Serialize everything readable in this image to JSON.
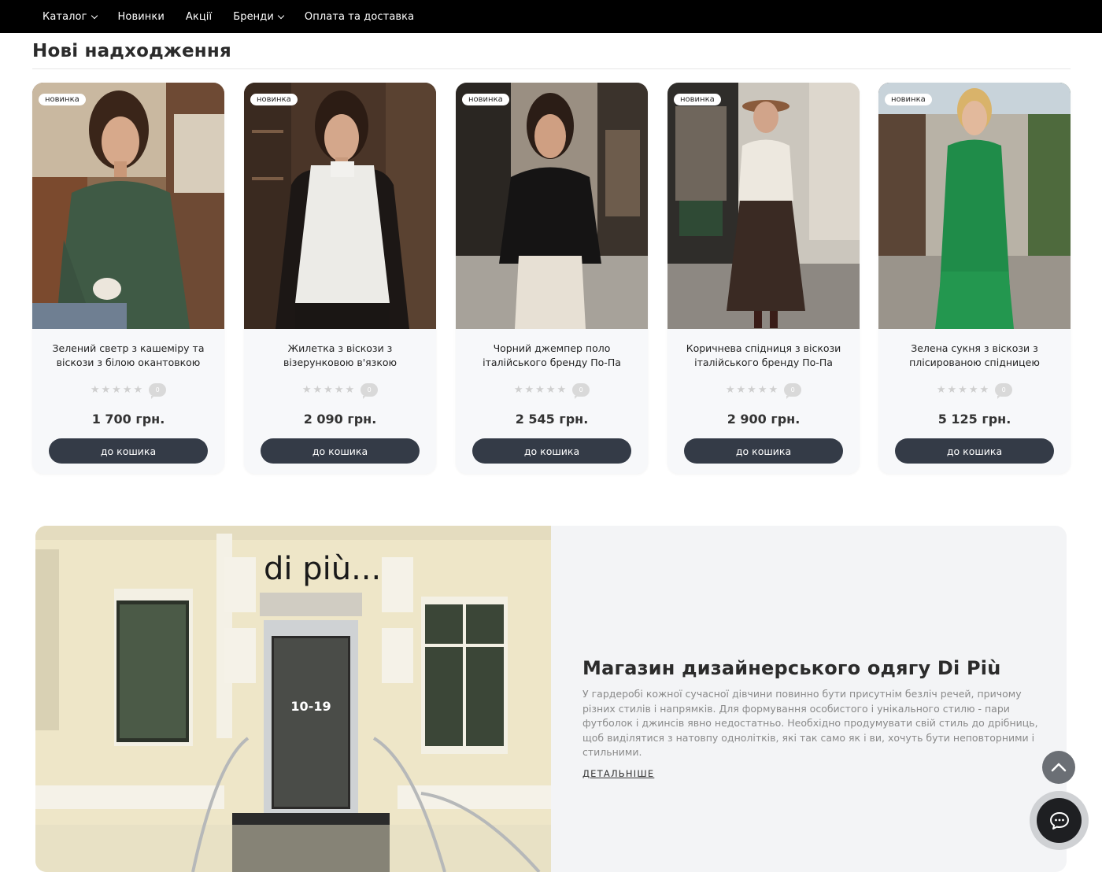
{
  "nav": {
    "items": [
      {
        "label": "Каталог",
        "dropdown": true
      },
      {
        "label": "Новинки",
        "dropdown": false
      },
      {
        "label": "Акції",
        "dropdown": false
      },
      {
        "label": "Бренди",
        "dropdown": true
      },
      {
        "label": "Оплата та доставка",
        "dropdown": false
      }
    ]
  },
  "section": {
    "title": "Нові надходження"
  },
  "products": [
    {
      "badge": "новинка",
      "name": "Зелений светр з кашеміру та віскози з білою окантовкою",
      "price": "1 700 грн.",
      "reviews": "0",
      "button": "до кошика"
    },
    {
      "badge": "новинка",
      "name": "Жилетка з віскози з візерунковою в'язкою",
      "price": "2 090 грн.",
      "reviews": "0",
      "button": "до кошика"
    },
    {
      "badge": "новинка",
      "name": "Чорний джемпер поло італійського бренду По-Па",
      "price": "2 545 грн.",
      "reviews": "0",
      "button": "до кошика"
    },
    {
      "badge": "новинка",
      "name": "Коричнева спідниця з віскози італійського бренду По-Па",
      "price": "2 900 грн.",
      "reviews": "0",
      "button": "до кошика"
    },
    {
      "badge": "новинка",
      "name": "Зелена сукня з віскози з плісированою спідницею",
      "price": "5 125 грн.",
      "reviews": "0",
      "button": "до кошика"
    }
  ],
  "store": {
    "sign": "di più...",
    "door_number": "10-19",
    "title": "Магазин дизайнерського одягу Di Più",
    "text": "У гардеробі кожної сучасної дівчини повинно бути присутнім безліч речей, причому різних стилів і напрямків. Для формування особистого і унікального стилю - пари футболок і джинсів явно недостатньо. Необхідно продумувати свій стиль до дрібниць, щоб виділятися з натовпу однолітків, які так само як і ви, хочуть бути неповторними і стильними.",
    "more_link": "ДЕТАЛЬНІШЕ"
  },
  "floating": {
    "scroll_top_icon": "chevron-up-icon",
    "chat_icon": "chat-icon"
  }
}
